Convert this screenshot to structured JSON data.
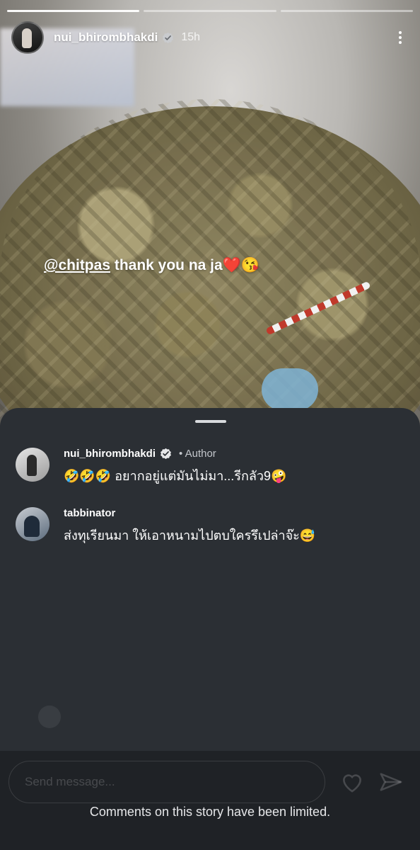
{
  "story": {
    "progress_segments": [
      {
        "done": true
      },
      {
        "done": false
      },
      {
        "done": false
      }
    ],
    "header": {
      "username": "nui_bhirombhakdi",
      "verified": true,
      "time": "15h"
    },
    "caption": {
      "mention": "@chitpas",
      "text": " thank you na ja❤️😘"
    }
  },
  "comments": [
    {
      "username": "nui_bhirombhakdi",
      "verified": true,
      "badge": "• Author",
      "text": "🤣🤣🤣 อยากอยู่แต่มันไม่มา...รีกลัว9🤪"
    },
    {
      "username": "tabbinator",
      "verified": false,
      "badge": "",
      "text": "ส่งทุเรียนมา ให้เอาหนามไปตบใครรึเปล่าจ๊ะ😅"
    }
  ],
  "composer": {
    "placeholder": "Send message..."
  },
  "notice": "Comments on this story have been limited.",
  "colors": {
    "sheet": "#2b2f34",
    "background": "#1f2226",
    "verified": "#3897f0"
  },
  "icons": {
    "more": "more-vertical-icon",
    "like": "heart-icon",
    "share": "paper-plane-icon",
    "verified": "verified-badge-icon"
  }
}
